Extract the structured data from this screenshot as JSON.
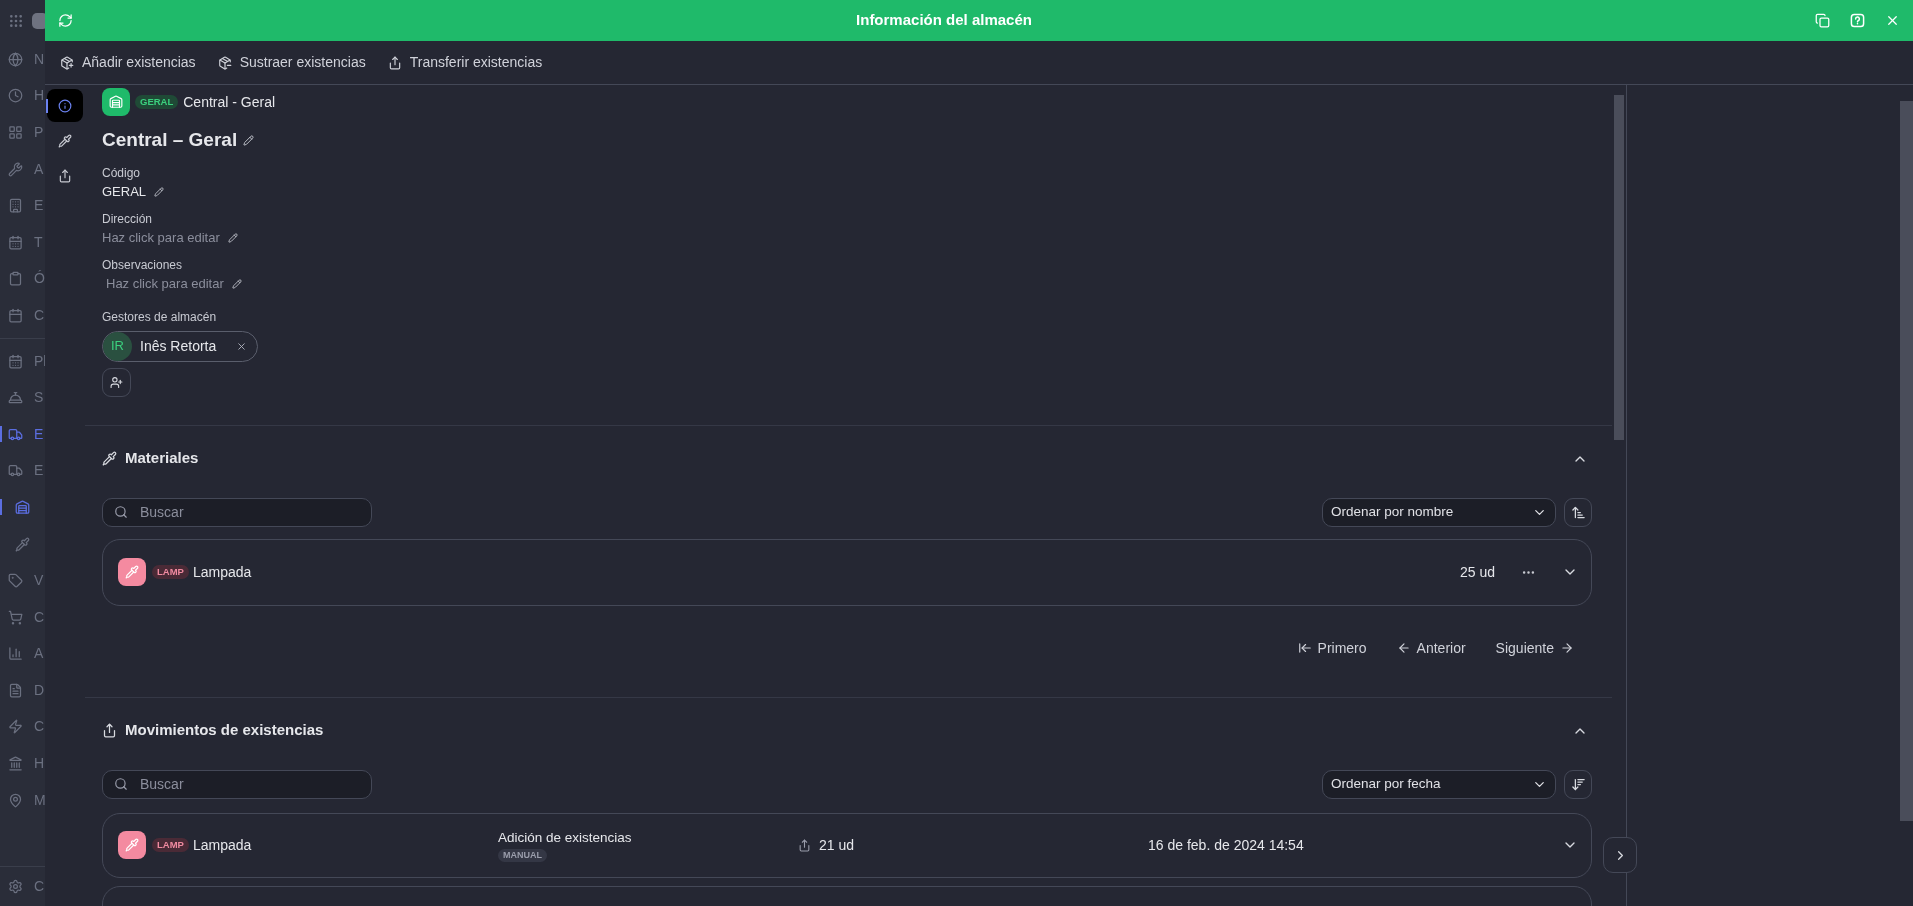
{
  "sidebar": {
    "groups": [
      {
        "items": [
          {
            "label": "N",
            "selected": false
          },
          {
            "label": "H",
            "selected": false
          },
          {
            "label": "P",
            "selected": false
          },
          {
            "label": "A",
            "selected": false
          },
          {
            "label": "E",
            "selected": false
          },
          {
            "label": "T",
            "selected": false
          },
          {
            "label": "Ó",
            "selected": false
          },
          {
            "label": "C",
            "selected": false
          }
        ]
      },
      {
        "items": [
          {
            "label": "Pl",
            "selected": false
          },
          {
            "label": "S",
            "selected": false
          },
          {
            "label": "E",
            "selected": true
          },
          {
            "label": "E",
            "selected": false,
            "expanded": true,
            "children": [
              {
                "selected": true
              },
              {
                "selected": false
              }
            ]
          },
          {
            "label": "V",
            "selected": false
          },
          {
            "label": "C",
            "selected": false
          },
          {
            "label": "A",
            "selected": false
          },
          {
            "label": "D",
            "selected": false
          },
          {
            "label": "C",
            "selected": false
          },
          {
            "label": "H",
            "selected": false
          },
          {
            "label": "M",
            "selected": false
          }
        ]
      }
    ],
    "footer": {
      "label": "C"
    }
  },
  "panel": {
    "title": "Información del almacén",
    "toolbar": [
      {
        "label": "Añadir existencias"
      },
      {
        "label": "Sustraer existencias"
      },
      {
        "label": "Transferir existencias"
      }
    ],
    "side_tabs": [
      {
        "selected": true
      },
      {
        "selected": false
      },
      {
        "selected": false
      }
    ],
    "breadcrumb": {
      "code": "GERAL",
      "name": "Central - Geral"
    },
    "heading": "Central – Geral",
    "fields": [
      {
        "kind": "value",
        "label": "Código",
        "text": "GERAL"
      },
      {
        "kind": "empty",
        "label": "Dirección",
        "text": "Haz click para editar"
      },
      {
        "kind": "empty",
        "label": "Observaciones",
        "text": "Haz click para editar"
      }
    ],
    "managers": {
      "label": "Gestores de almacén",
      "people": [
        {
          "initials": "IR",
          "name": "Inês Retorta"
        }
      ]
    },
    "materials": {
      "title": "Materiales",
      "expanded": true,
      "search": {
        "placeholder": "Buscar"
      },
      "sort": "Ordenar por nombre",
      "items": [
        {
          "code": "LAMP",
          "name": "Lampada",
          "quantity": "25 ud"
        }
      ],
      "pagination": [
        "Primero",
        "Anterior",
        "Siguiente"
      ]
    },
    "movements": {
      "title": "Movimientos de existencias",
      "expanded": true,
      "search": {
        "placeholder": "Buscar"
      },
      "sort": "Ordenar por fecha",
      "items": [
        {
          "kind": "full",
          "code": "LAMP",
          "name": "Lampada",
          "type": "Adición de existencias",
          "source": "MANUAL",
          "quantity": "21 ud",
          "date": "16 de feb. de 2024 14:54"
        },
        {
          "kind": "cut"
        }
      ]
    }
  }
}
